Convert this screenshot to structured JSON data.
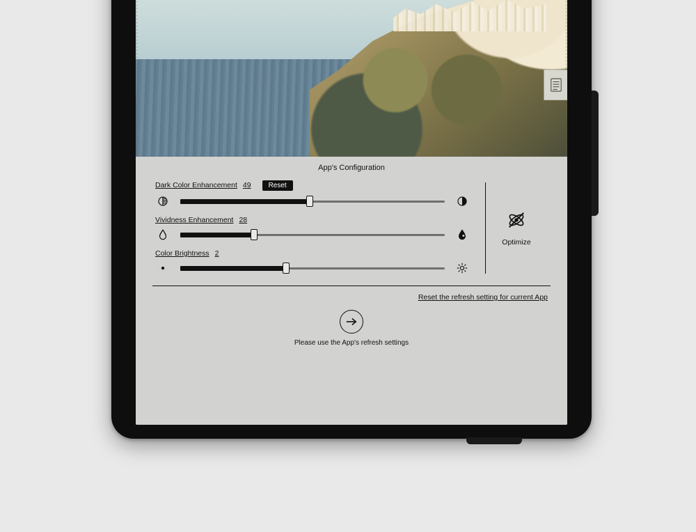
{
  "panel": {
    "title": "App's Configuration",
    "reset_button": "Reset",
    "darkColor": {
      "label": "Dark Color Enhancement",
      "value": "49",
      "percent": 49
    },
    "vividness": {
      "label": "Vividness Enhancement",
      "value": "28",
      "percent": 28
    },
    "brightness": {
      "label": "Color Brightness",
      "value": "2",
      "percent": 40
    },
    "optimize_label": "Optimize",
    "reset_link": "Reset the refresh setting for current App",
    "hint": "Please use the App's refresh settings"
  }
}
